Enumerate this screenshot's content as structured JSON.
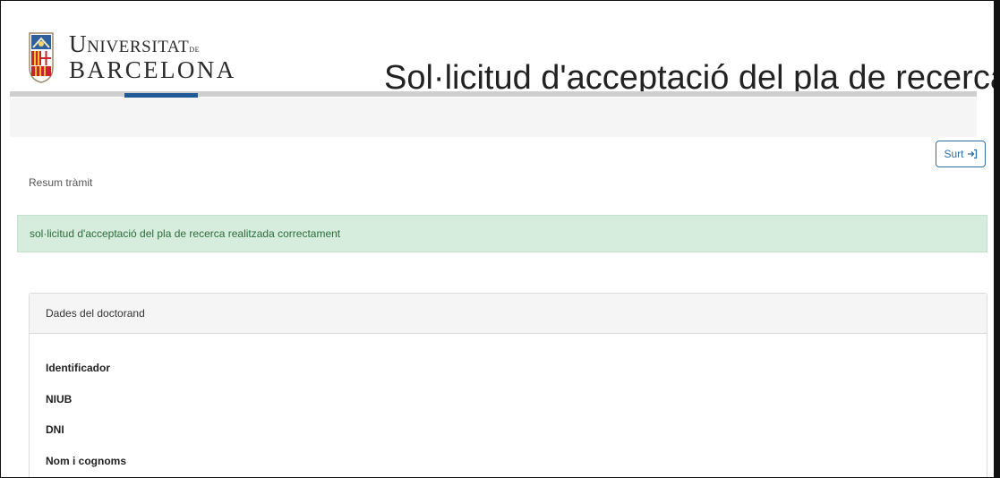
{
  "header": {
    "logo": {
      "line1": "Universitat",
      "line1_suffix": "de",
      "line2": "BARCELONA"
    },
    "title": "Sol·licitud d'acceptació del pla de recerca"
  },
  "toolbar": {
    "exit_label": "Surt"
  },
  "breadcrumb": "Resum tràmit",
  "alert": {
    "message": "sol·licitud d'acceptació del pla de recerca realitzada correctament",
    "color": "#d6ecdc"
  },
  "panel": {
    "title": "Dades del doctorand",
    "fields": [
      {
        "label": "Identificador",
        "value": ""
      },
      {
        "label": "NIUB",
        "value": ""
      },
      {
        "label": "DNI",
        "value": ""
      },
      {
        "label": "Nom i cognoms",
        "value": ""
      }
    ]
  },
  "colors": {
    "brand_blue": "#1f5a96",
    "link_blue": "#2e6da4"
  },
  "icons": {
    "exit": "sign-out-icon",
    "logo": "university-shield-icon"
  }
}
